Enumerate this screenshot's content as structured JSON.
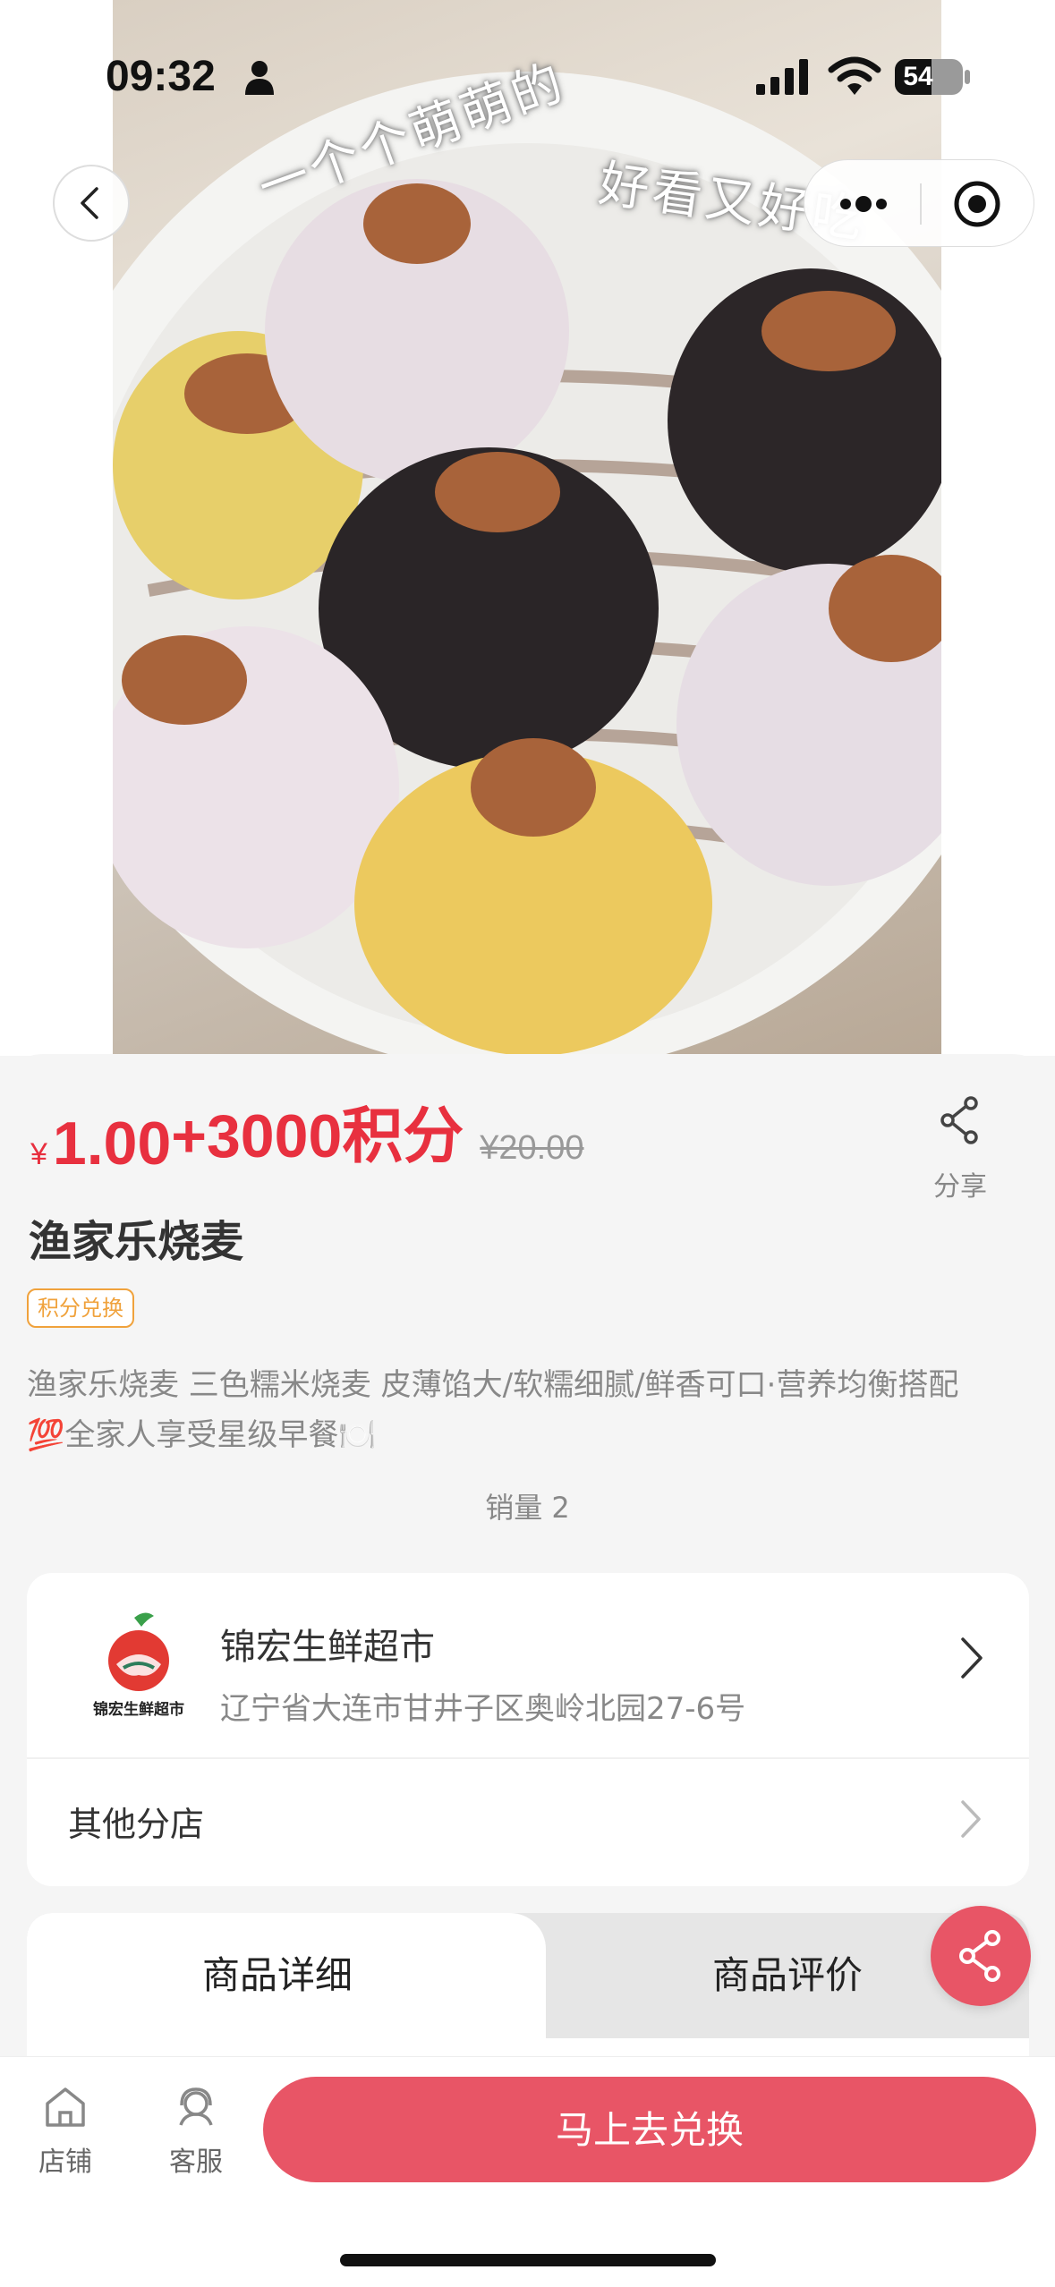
{
  "status_bar": {
    "time": "09:32",
    "battery_level": "54",
    "battery_fraction": 0.54
  },
  "hero": {
    "overlay_text_left": "一个个萌萌的",
    "overlay_text_right": "好看又好吃",
    "icon": "dumpling-photo"
  },
  "nav": {
    "back_icon": "chevron-left-icon",
    "more_icon": "more-dots-icon",
    "close_icon": "target-circle-icon"
  },
  "price": {
    "currency_symbol": "¥",
    "value": "1.00",
    "points": "+3000积分",
    "original": "¥20.00",
    "color": "#e8303f"
  },
  "share": {
    "label": "分享"
  },
  "product": {
    "title": "渔家乐烧麦",
    "tag": "积分兑换",
    "description_line1": "渔家乐烧麦     三色糯米烧麦 皮薄馅大/软糯细腻/鲜香可口·营养均衡搭配",
    "description_line2": "💯全家人享受星级早餐🍽️",
    "sales": "销量 2"
  },
  "store": {
    "logo_text": "锦宏生鲜超市",
    "name": "锦宏生鲜超市",
    "address": "辽宁省大连市甘井子区奥岭北园27-6号",
    "other_branches": "其他分店"
  },
  "tabs": [
    {
      "label": "商品详细",
      "active": true
    },
    {
      "label": "商品评价",
      "active": false
    }
  ],
  "bottom_bar": {
    "store_label": "店铺",
    "service_label": "客服",
    "redeem_label": "马上去兑换"
  },
  "colors": {
    "accent": "#e85566",
    "price": "#e8303f",
    "tag_orange": "#f0a23c"
  }
}
